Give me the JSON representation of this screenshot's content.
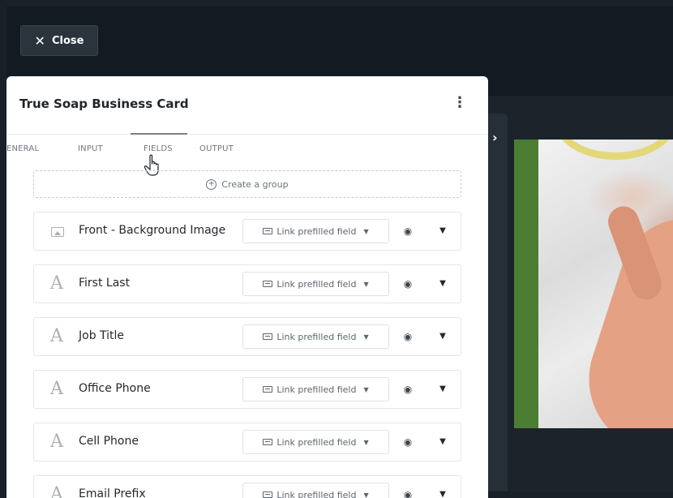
{
  "toolbar": {
    "close_label": "Close"
  },
  "panel": {
    "title": "True Soap Business Card",
    "tabs": [
      {
        "label": "GENERAL"
      },
      {
        "label": "INPUT"
      },
      {
        "label": "FIELDS"
      },
      {
        "label": "OUTPUT"
      }
    ],
    "active_tab": "FIELDS",
    "create_group_label": "Create a group",
    "fields": [
      {
        "label": "Front - Background Image",
        "icon": "image-icon",
        "link_label": "Link prefilled field"
      },
      {
        "label": "First Last",
        "icon": "text-icon",
        "link_label": "Link prefilled field"
      },
      {
        "label": "Job Title",
        "icon": "text-icon",
        "link_label": "Link prefilled field"
      },
      {
        "label": "Office Phone",
        "icon": "text-icon",
        "link_label": "Link prefilled field"
      },
      {
        "label": "Cell Phone",
        "icon": "text-icon",
        "link_label": "Link prefilled field"
      },
      {
        "label": "Email Prefix",
        "icon": "text-icon",
        "link_label": "Link prefilled field"
      }
    ]
  },
  "colors": {
    "background": "#1a2028",
    "panel": "#ffffff",
    "accent_green": "#4b7d33"
  }
}
